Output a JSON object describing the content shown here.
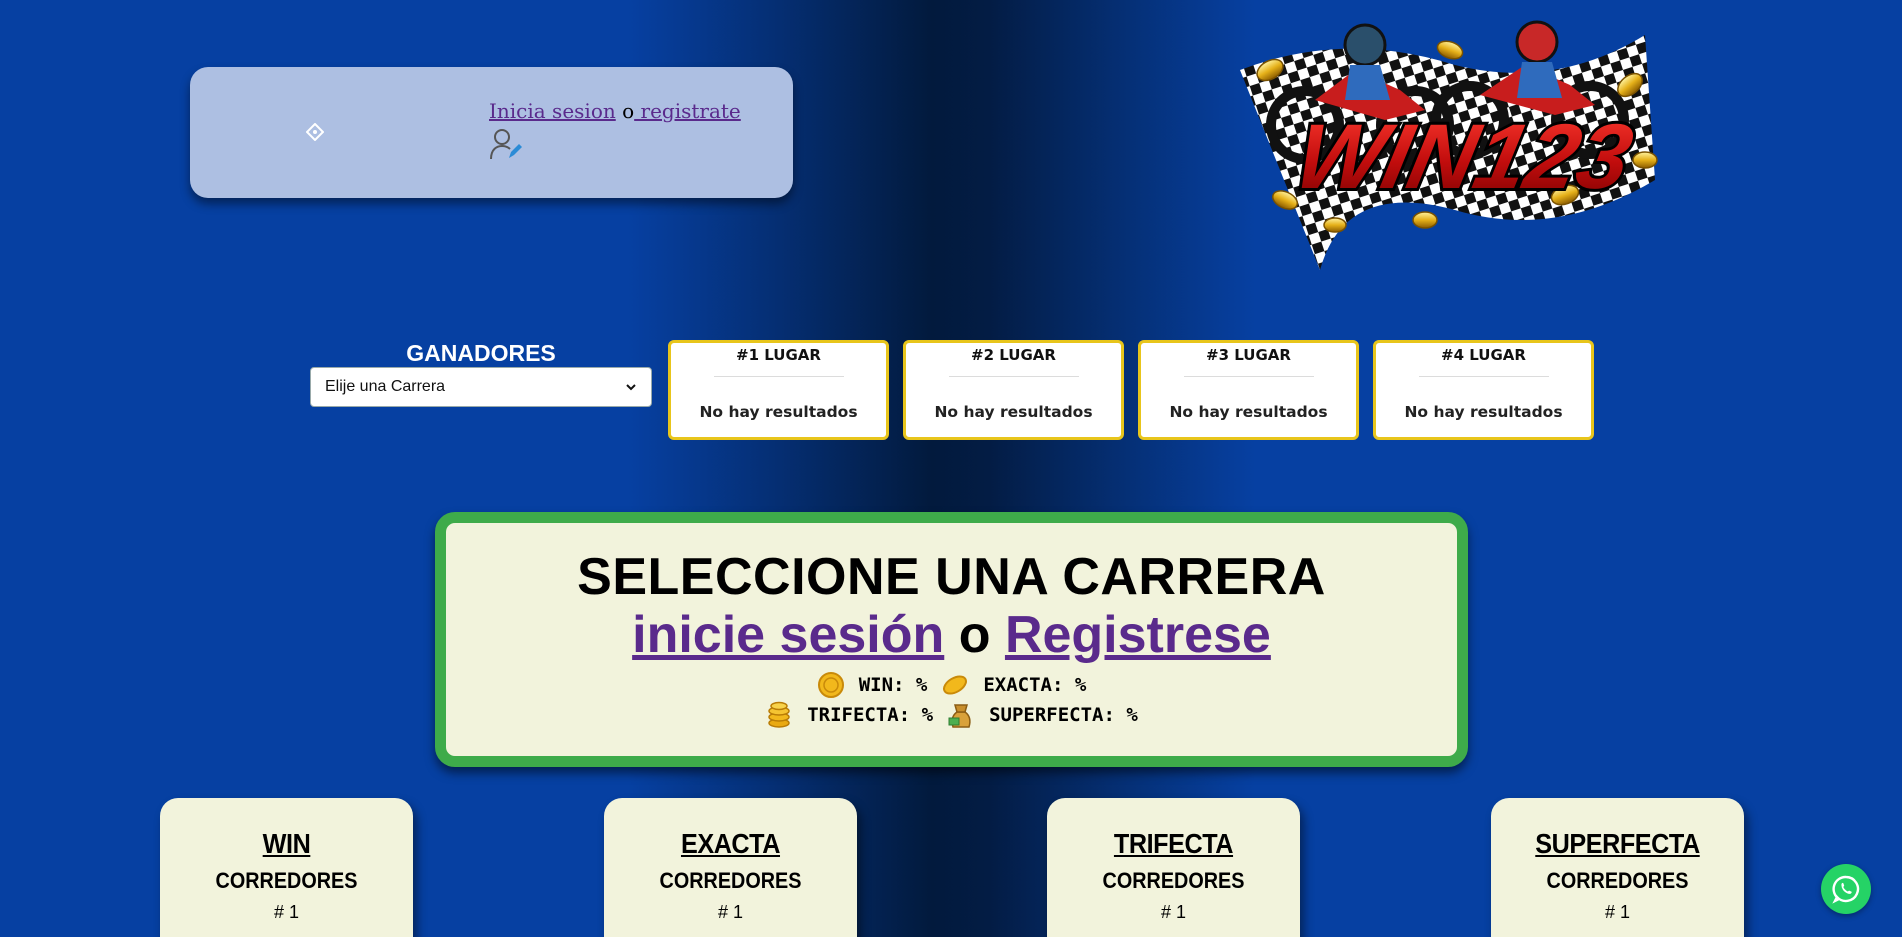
{
  "login": {
    "login_link": "Inicia sesion",
    "separator": "o",
    "register_link": " registrate"
  },
  "logo": {
    "text": "WIN123"
  },
  "winners": {
    "title": "GANADORES",
    "select_value": "Elije una Carrera",
    "places": [
      {
        "title": "#1 LUGAR",
        "result": "No hay resultados"
      },
      {
        "title": "#2 LUGAR",
        "result": "No hay resultados"
      },
      {
        "title": "#3 LUGAR",
        "result": "No hay resultados"
      },
      {
        "title": "#4 LUGAR",
        "result": "No hay resultados"
      }
    ]
  },
  "banner": {
    "title": "SELECCIONE UNA CARRERA",
    "login_link": "inicie sesión",
    "separator": "o",
    "register_link": "Registrese",
    "odds": {
      "win": "WIN: %",
      "exacta": "EXACTA: %",
      "trifecta": "TRIFECTA: %",
      "superfecta": "SUPERFECTA: %"
    }
  },
  "bets": [
    {
      "title": "WIN",
      "subtitle": "CORREDORES",
      "number": "# 1"
    },
    {
      "title": "EXACTA",
      "subtitle": "CORREDORES",
      "number": "# 1"
    },
    {
      "title": "TRIFECTA",
      "subtitle": "CORREDORES",
      "number": "# 1"
    },
    {
      "title": "SUPERFECTA",
      "subtitle": "CORREDORES",
      "number": "# 1"
    }
  ],
  "colors": {
    "background": "#0640a2",
    "banner_border": "#3eab4a",
    "card_border": "#e8c51b",
    "link": "#5a2a8c",
    "whatsapp": "#25d366"
  },
  "icons": [
    "diamond-icon",
    "user-edit-icon",
    "coin-icon",
    "pill-coin-icon",
    "coin-stack-icon",
    "money-bag-icon",
    "whatsapp-icon",
    "chevron-down-icon"
  ]
}
